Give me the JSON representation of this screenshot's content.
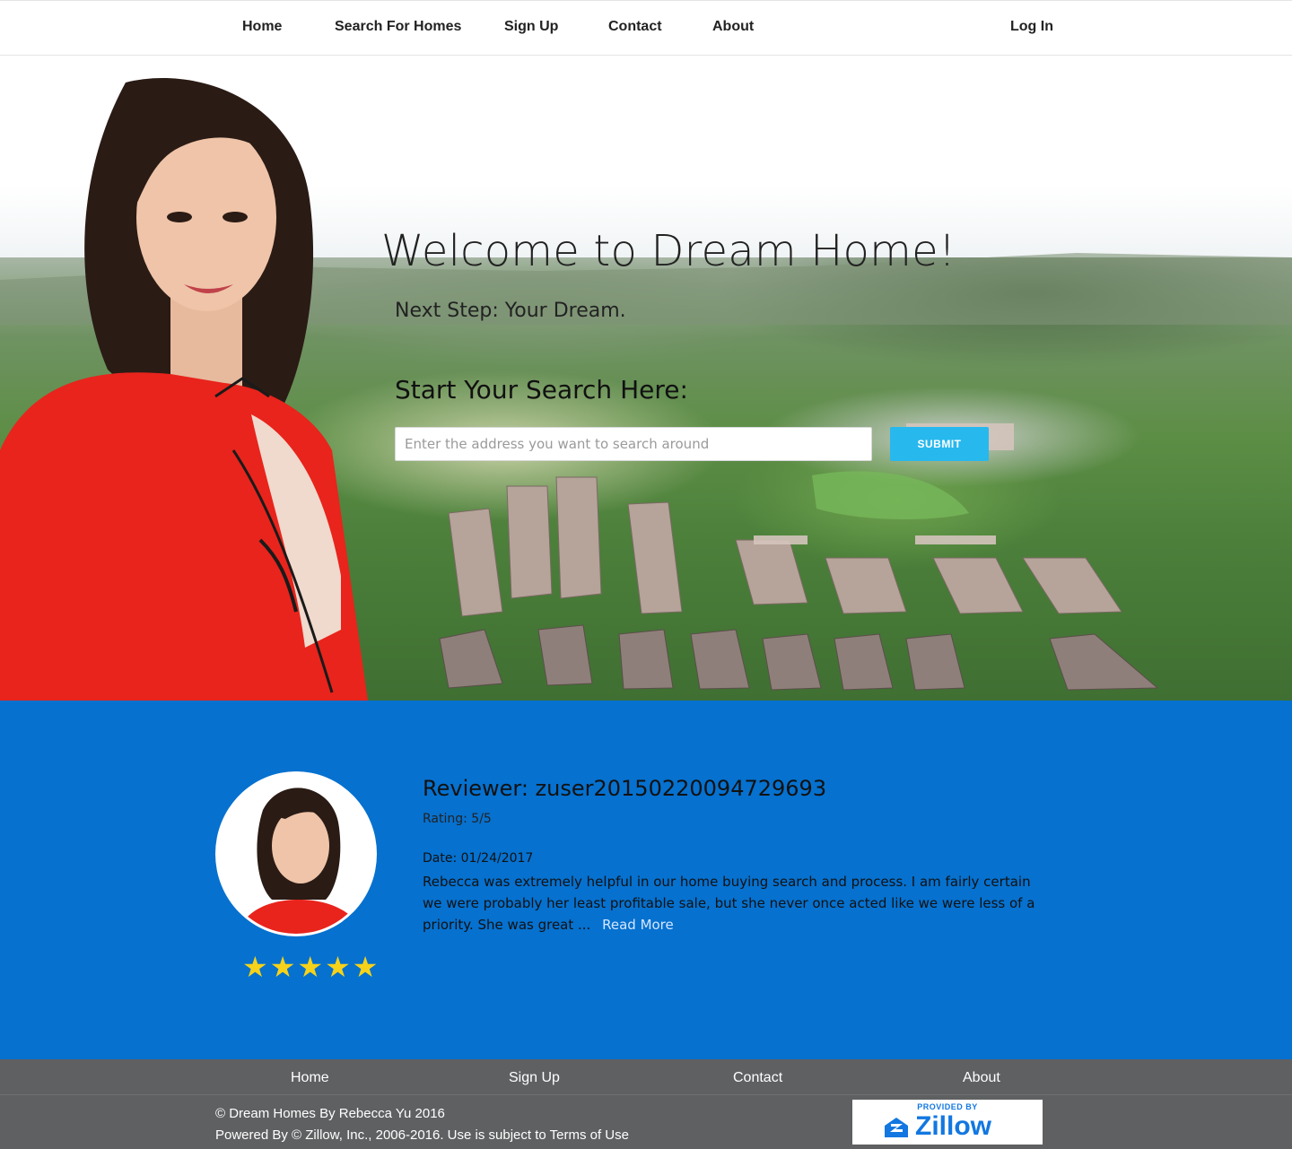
{
  "nav": {
    "items": [
      "Home",
      "Search For Homes",
      "Sign Up",
      "Contact",
      "About"
    ],
    "login": "Log In"
  },
  "hero": {
    "title": "Welcome to Dream Home!",
    "subtitle": "Next Step: Your Dream.",
    "search_label": "Start Your Search Here:",
    "search_placeholder": "Enter the address you want to search around",
    "submit_label": "SUBMIT"
  },
  "review": {
    "title": "Reviewer: zuser20150220094729693",
    "rating": "Rating: 5/5",
    "stars": "★★★★★",
    "date": "Date: 01/24/2017",
    "text": "Rebecca was extremely helpful in our home buying search and process. I am fairly certain we were probably her least profitable sale, but she never once acted like we were less of a priority. She was great ...",
    "read_more": "Read More"
  },
  "footer": {
    "links": [
      "Home",
      "Sign Up",
      "Contact",
      "About"
    ],
    "copyright": "© Dream Homes By Rebecca Yu 2016",
    "powered": "Powered By © Zillow, Inc., 2006-2016. Use is subject to Terms of Use",
    "zillow_provided": "PROVIDED BY",
    "zillow_name": "Zillow"
  },
  "colors": {
    "review_bg": "#0671cf",
    "submit_bg": "#27b8ee",
    "footer_bg": "#5f6062",
    "stars": "#f6d21a",
    "agent_jacket": "#e8241c"
  }
}
